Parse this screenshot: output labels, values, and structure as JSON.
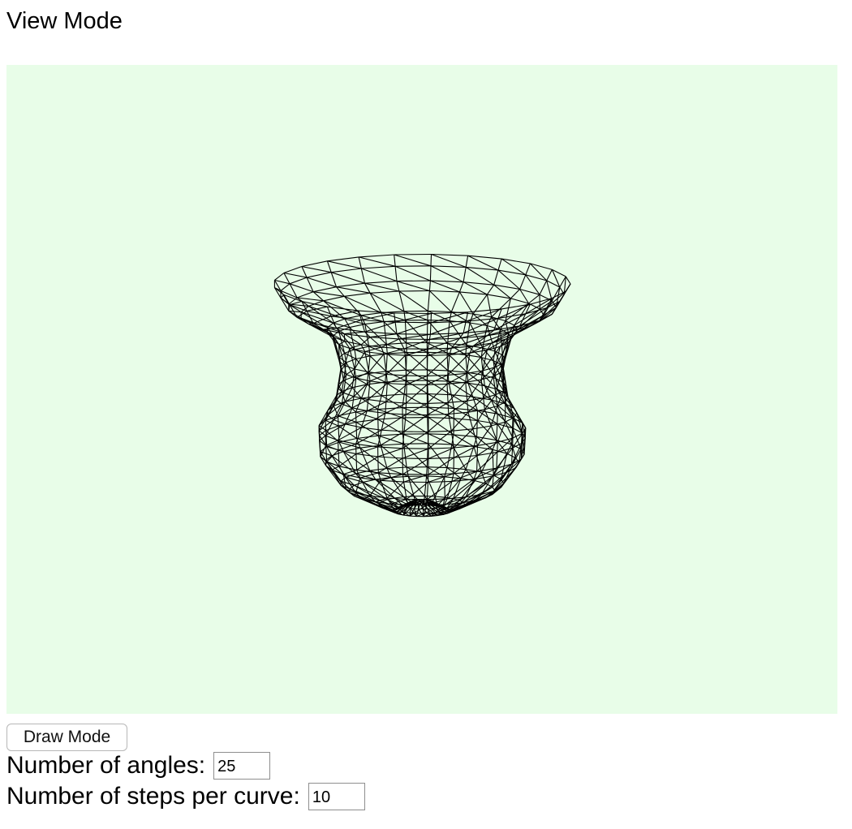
{
  "page": {
    "title": "View Mode"
  },
  "viewport": {
    "background_color": "#e8fde8",
    "wire_color": "#000000"
  },
  "controls": {
    "mode_button_label": "Draw Mode",
    "angles_label": "Number of angles:",
    "angles_value": "25",
    "steps_label": "Number of steps per curve:",
    "steps_value": "10"
  }
}
